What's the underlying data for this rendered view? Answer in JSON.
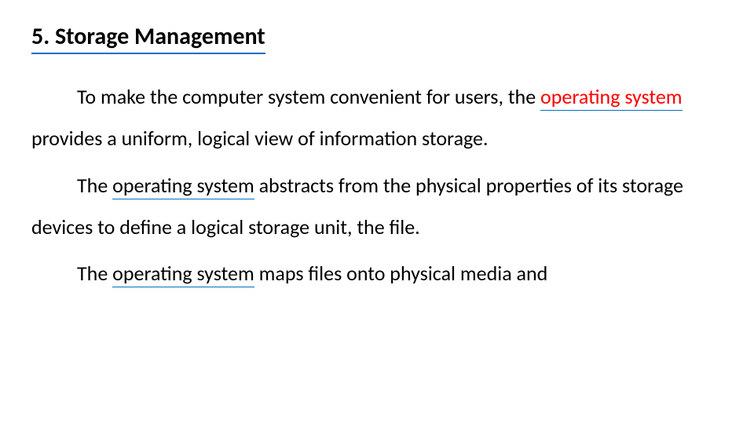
{
  "heading": "5. Storage Management",
  "p1a": "To make the computer system convenient for users, the ",
  "p1_term": "operating system",
  "p1b": " provides a uniform, logical view of information storage.",
  "p2a": "The ",
  "p2_term": "operating system",
  "p2b": " abstracts from the physical properties of its storage devices to define a logical storage unit, the file.",
  "p3a": "The ",
  "p3_term": "operating system",
  "p3b": " maps files onto physical media and"
}
